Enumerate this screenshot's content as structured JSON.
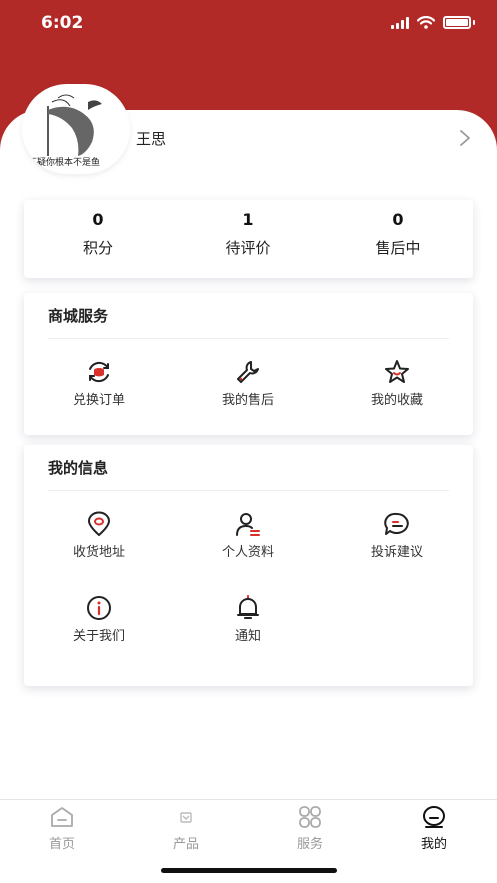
{
  "status_bar": {
    "time": "6:02"
  },
  "profile": {
    "name": "王思",
    "avatar_caption": "不疑你根本不是鱼"
  },
  "stats": [
    {
      "value": "0",
      "label": "积分"
    },
    {
      "value": "1",
      "label": "待评价"
    },
    {
      "value": "0",
      "label": "售后中"
    }
  ],
  "shop_services": {
    "title": "商城服务",
    "items": [
      {
        "label": "兑换订单",
        "icon": "exchange-orders-icon"
      },
      {
        "label": "我的售后",
        "icon": "wrench-icon"
      },
      {
        "label": "我的收藏",
        "icon": "star-icon"
      }
    ]
  },
  "my_info": {
    "title": "我的信息",
    "items": [
      {
        "label": "收货地址",
        "icon": "location-icon"
      },
      {
        "label": "个人资料",
        "icon": "user-profile-icon"
      },
      {
        "label": "投诉建议",
        "icon": "chat-bubble-icon"
      },
      {
        "label": "关于我们",
        "icon": "info-icon"
      },
      {
        "label": "通知",
        "icon": "bell-icon"
      }
    ]
  },
  "tabbar": {
    "items": [
      {
        "label": "首页",
        "icon": "home-icon",
        "active": false
      },
      {
        "label": "产品",
        "icon": "product-icon",
        "active": false
      },
      {
        "label": "服务",
        "icon": "services-grid-icon",
        "active": false
      },
      {
        "label": "我的",
        "icon": "me-icon",
        "active": true
      }
    ]
  },
  "colors": {
    "brand_red": "#b22a28",
    "accent_red": "#d9302b",
    "icon_dark": "#222222"
  }
}
